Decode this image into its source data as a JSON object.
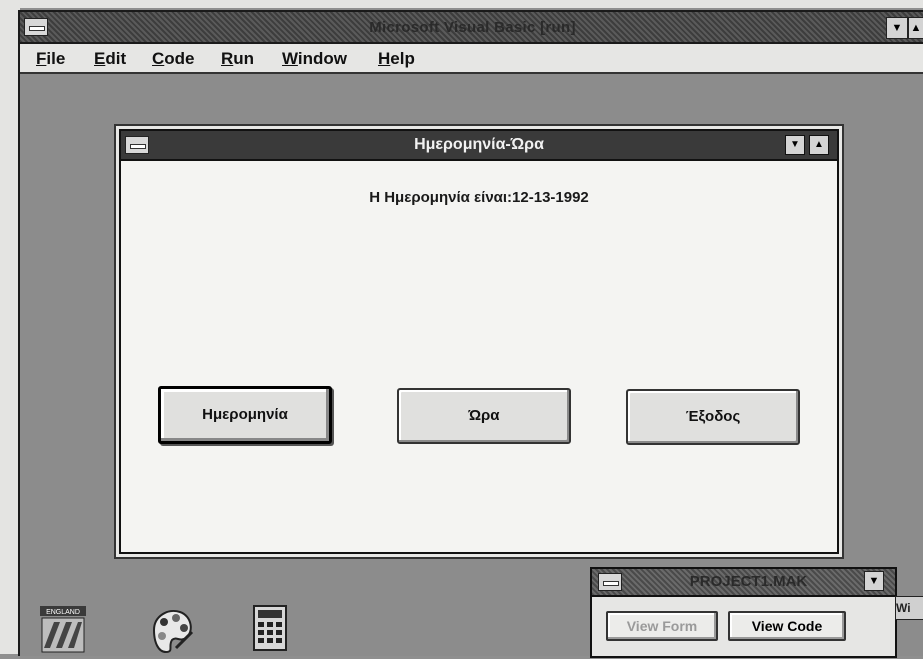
{
  "app": {
    "title": "Microsoft Visual Basic [run]"
  },
  "menu": {
    "file": {
      "first": "F",
      "rest": "ile"
    },
    "edit": {
      "first": "E",
      "rest": "dit"
    },
    "code": {
      "first": "C",
      "rest": "ode"
    },
    "run": {
      "first": "R",
      "rest": "un"
    },
    "window": {
      "first": "W",
      "rest": "indow"
    },
    "help": {
      "first": "H",
      "rest": "elp"
    }
  },
  "form": {
    "title": "Ημερομηνία-Ώρα",
    "date_label": "Η Ημερομηνία είναι:12-13-1992",
    "buttons": {
      "date": "Ημερομηνία",
      "time": "Ώρα",
      "exit": "Έξοδος"
    }
  },
  "project": {
    "title": "PROJECT1.MAK",
    "view_form": "View Form",
    "view_code": "View Code",
    "side_tab": "Wi"
  },
  "icons": {
    "desktop": [
      "england-icon",
      "palette-icon",
      "calculator-icon"
    ]
  },
  "glyphs": {
    "down": "▼",
    "up": "▲"
  }
}
